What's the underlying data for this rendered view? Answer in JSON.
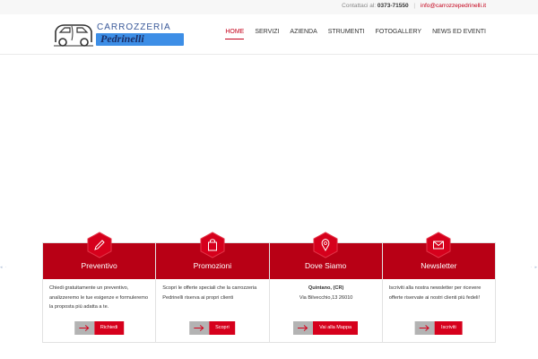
{
  "topbar": {
    "contact_label": "Contattaci al:",
    "phone": "0373-71550",
    "separator": "|",
    "email": "info@carrozzepedrinelli.it"
  },
  "logo": {
    "brand_top": "CARROZZERIA",
    "brand_name": "Pedrinelli"
  },
  "nav": {
    "items": [
      {
        "label": "HOME"
      },
      {
        "label": "SERVIZI"
      },
      {
        "label": "AZIENDA"
      },
      {
        "label": "STRUMENTI"
      },
      {
        "label": "FOTOGALLERY"
      },
      {
        "label": "NEWS ED EVENTI"
      }
    ]
  },
  "colors": {
    "accent": "#c4001a",
    "box_header": "#b80015",
    "button": "#d6001c",
    "button_arrow": "#b3b3b3",
    "logo_bar": "#3d8ee6"
  },
  "services": [
    {
      "title": "Preventivo",
      "icon": "pencil-icon",
      "text": "Chiedi gratuitamente un preventivo, analizzeremo le tue esigenze e formuleremo la proposta più adatta a te.",
      "button": "Richiedi"
    },
    {
      "title": "Promozioni",
      "icon": "shopping-bag-icon",
      "text": "Scopri le offerte speciali che la carrozzeria Pedrinelli riserva ai propri clienti",
      "button": "Scopri"
    },
    {
      "title": "Dove Siamo",
      "icon": "map-pin-icon",
      "place": "Quintano, (CR)",
      "address": "Via Bilvecchio,13 26010",
      "button": "Vai alla Mappa"
    },
    {
      "title": "Newsletter",
      "icon": "envelope-icon",
      "text": "Iscriviti alla nostra newsletter per ricevere offerte riservate ai nostri clienti più fedeli!",
      "button": "Iscriviti"
    }
  ]
}
